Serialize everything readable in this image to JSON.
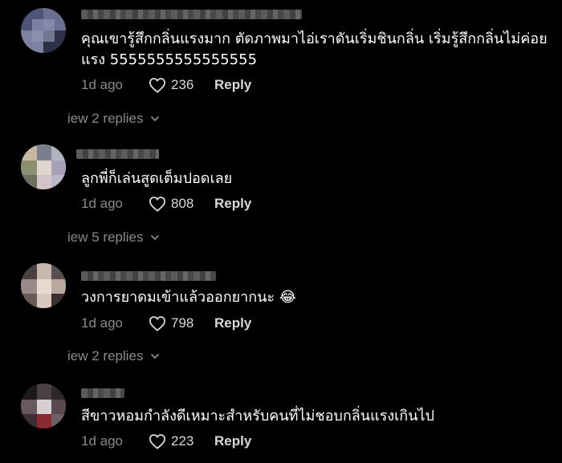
{
  "comments": [
    {
      "text": "คุณเขารู้สึกกลิ่นแรงมาก ตัดภาพมาไอ่เราดันเริ่มชินกลิ่น เริ่มรู้สึกกลิ่นไม่ค่อยแรง 5555555555555555",
      "time": "1d ago",
      "likes": "236",
      "reply_label": "Reply",
      "view_replies": "iew 2 replies",
      "avatar_icon": "pixelated-avatar"
    },
    {
      "text": "ลูกพี่ก็เล่นสูดเต็มปอดเลย",
      "time": "1d ago",
      "likes": "808",
      "reply_label": "Reply",
      "view_replies": "iew 5 replies",
      "avatar_icon": "pixelated-avatar"
    },
    {
      "text": "วงการยาดมเข้าแล้วออกยากนะ 😂",
      "time": "1d ago",
      "likes": "798",
      "reply_label": "Reply",
      "view_replies": "iew 2 replies",
      "avatar_icon": "pixelated-avatar"
    },
    {
      "text": "สีขาวหอมกำลังดีเหมาะสำหรับคนที่ไม่ชอบกลิ่นแรงเกินไป",
      "time": "1d ago",
      "likes": "223",
      "reply_label": "Reply",
      "avatar_icon": "pixelated-avatar"
    }
  ],
  "icons": {
    "like": "heart-outline-icon",
    "expand": "chevron-down-icon"
  },
  "colors": {
    "background": "#000000",
    "text": "#ffffff",
    "muted": "#8a8a8a",
    "action": "#d8d8d8"
  }
}
